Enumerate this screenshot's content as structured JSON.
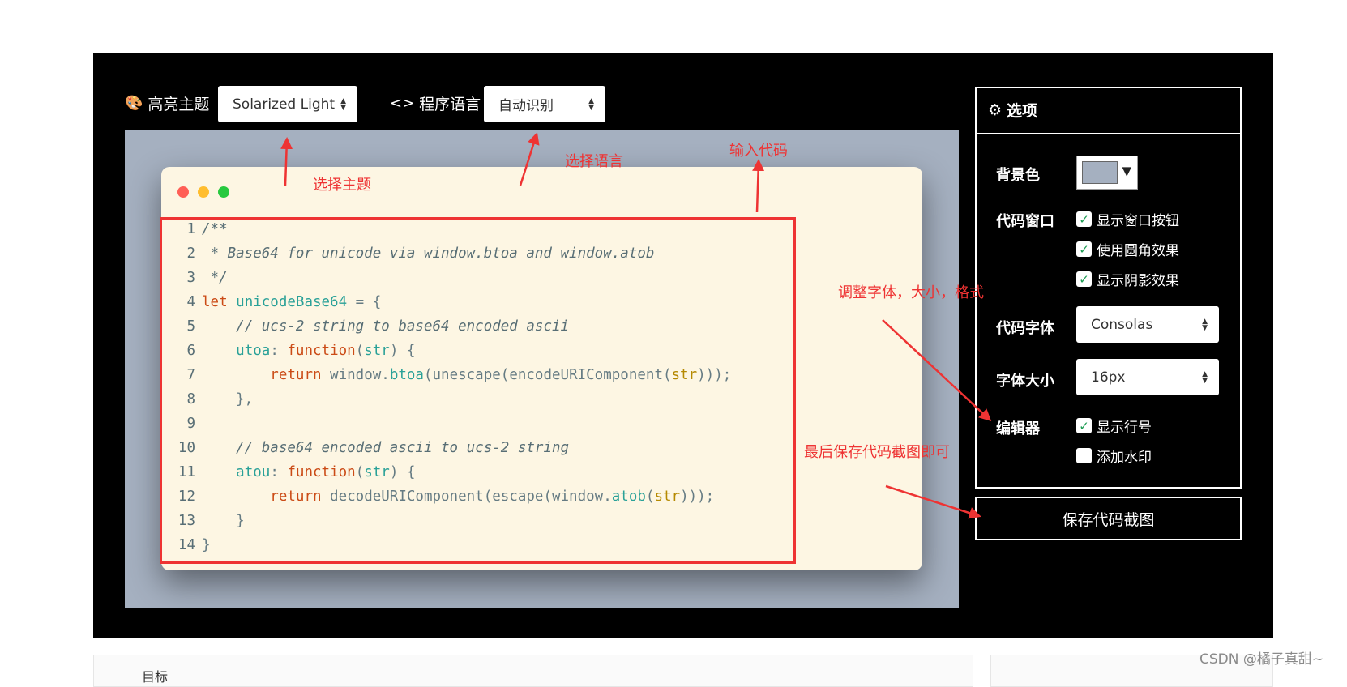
{
  "toolbar": {
    "theme_label": "高亮主题",
    "theme_icon": "palette-icon",
    "theme_value": "Solarized Light",
    "lang_label": "程序语言",
    "lang_icon": "code-icon",
    "lang_value": "自动识别"
  },
  "window_buttons": {
    "close_color": "#ff5f56",
    "minimize_color": "#ffbd2e",
    "maximize_color": "#27c93f"
  },
  "code_lines": [
    {
      "n": "1",
      "parts": [
        {
          "c": "cm",
          "t": "/**"
        }
      ]
    },
    {
      "n": "2",
      "parts": [
        {
          "c": "cm",
          "t": " * Base64 for unicode via window.btoa and window.atob"
        }
      ]
    },
    {
      "n": "3",
      "parts": [
        {
          "c": "cm",
          "t": " */"
        }
      ]
    },
    {
      "n": "4",
      "parts": [
        {
          "c": "kw",
          "t": "let"
        },
        {
          "c": "pl",
          "t": " "
        },
        {
          "c": "df",
          "t": "unicodeBase64"
        },
        {
          "c": "pl",
          "t": " = {"
        }
      ]
    },
    {
      "n": "5",
      "parts": [
        {
          "c": "pl",
          "t": "    "
        },
        {
          "c": "cm",
          "t": "// ucs-2 string to base64 encoded ascii"
        }
      ]
    },
    {
      "n": "6",
      "parts": [
        {
          "c": "pl",
          "t": "    "
        },
        {
          "c": "df",
          "t": "utoa"
        },
        {
          "c": "pl",
          "t": ": "
        },
        {
          "c": "kw",
          "t": "function"
        },
        {
          "c": "pl",
          "t": "("
        },
        {
          "c": "df",
          "t": "str"
        },
        {
          "c": "pl",
          "t": ") {"
        }
      ]
    },
    {
      "n": "7",
      "parts": [
        {
          "c": "pl",
          "t": "        "
        },
        {
          "c": "kw",
          "t": "return"
        },
        {
          "c": "pl",
          "t": " window."
        },
        {
          "c": "df",
          "t": "btoa"
        },
        {
          "c": "pl",
          "t": "(unescape(encodeURIComponent("
        },
        {
          "c": "st",
          "t": "str"
        },
        {
          "c": "pl",
          "t": ")));"
        }
      ]
    },
    {
      "n": "8",
      "parts": [
        {
          "c": "pl",
          "t": "    },"
        }
      ]
    },
    {
      "n": "9",
      "parts": [
        {
          "c": "pl",
          "t": ""
        }
      ]
    },
    {
      "n": "10",
      "parts": [
        {
          "c": "pl",
          "t": "    "
        },
        {
          "c": "cm",
          "t": "// base64 encoded ascii to ucs-2 string"
        }
      ]
    },
    {
      "n": "11",
      "parts": [
        {
          "c": "pl",
          "t": "    "
        },
        {
          "c": "df",
          "t": "atou"
        },
        {
          "c": "pl",
          "t": ": "
        },
        {
          "c": "kw",
          "t": "function"
        },
        {
          "c": "pl",
          "t": "("
        },
        {
          "c": "df",
          "t": "str"
        },
        {
          "c": "pl",
          "t": ") {"
        }
      ]
    },
    {
      "n": "12",
      "parts": [
        {
          "c": "pl",
          "t": "        "
        },
        {
          "c": "kw",
          "t": "return"
        },
        {
          "c": "pl",
          "t": " decodeURIComponent(escape(window."
        },
        {
          "c": "df",
          "t": "atob"
        },
        {
          "c": "pl",
          "t": "("
        },
        {
          "c": "st",
          "t": "str"
        },
        {
          "c": "pl",
          "t": ")));"
        }
      ]
    },
    {
      "n": "13",
      "parts": [
        {
          "c": "pl",
          "t": "    }"
        }
      ]
    },
    {
      "n": "14",
      "parts": [
        {
          "c": "pl",
          "t": "}"
        }
      ]
    }
  ],
  "options": {
    "title": "选项",
    "title_icon": "gear-icon",
    "bg_label": "背景色",
    "bg_color": "#a5b0c0",
    "window_label": "代码窗口",
    "show_window_buttons": "显示窗口按钮",
    "use_rounded": "使用圆角效果",
    "show_shadow": "显示阴影效果",
    "font_label": "代码字体",
    "font_value": "Consolas",
    "size_label": "字体大小",
    "size_value": "16px",
    "editor_label": "编辑器",
    "show_line_numbers": "显示行号",
    "add_watermark": "添加水印",
    "check_mark": "✓"
  },
  "save_button": "保存代码截图",
  "annotations": {
    "choose_theme": "选择主题",
    "choose_language": "选择语言",
    "input_code": "输入代码",
    "adjust_font": "调整字体，大小，格式",
    "save_hint": "最后保存代码截图即可",
    "color": "#ee3333"
  },
  "footer": {
    "card_text": "目标",
    "watermark": "CSDN @橘子真甜~"
  }
}
